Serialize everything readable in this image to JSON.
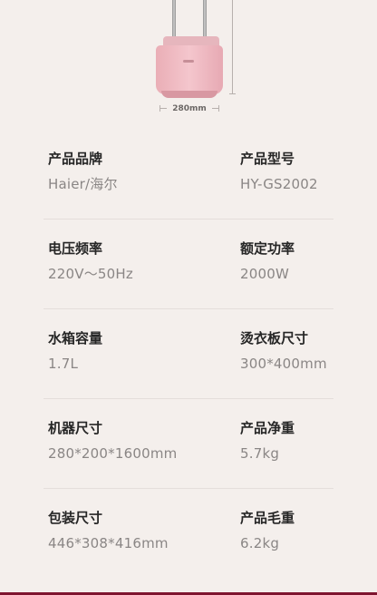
{
  "product_image": {
    "dimension_label": "280mm"
  },
  "specs": [
    {
      "left": {
        "label": "产品品牌",
        "value": "Haier/海尔"
      },
      "right": {
        "label": "产品型号",
        "value": "HY-GS2002"
      }
    },
    {
      "left": {
        "label": "电压频率",
        "value": "220V～50Hz"
      },
      "right": {
        "label": "额定功率",
        "value": "2000W"
      }
    },
    {
      "left": {
        "label": "水箱容量",
        "value": "1.7L"
      },
      "right": {
        "label": "烫衣板尺寸",
        "value": "300*400mm"
      }
    },
    {
      "left": {
        "label": "机器尺寸",
        "value": "280*200*1600mm"
      },
      "right": {
        "label": "产品净重",
        "value": "5.7kg"
      }
    },
    {
      "left": {
        "label": "包装尺寸",
        "value": "446*308*416mm"
      },
      "right": {
        "label": "产品毛重",
        "value": "6.2kg"
      }
    }
  ],
  "colors": {
    "background": "#f4efec",
    "product_pink": "#f0bcc3",
    "bottom_bar": "#7f1530"
  }
}
